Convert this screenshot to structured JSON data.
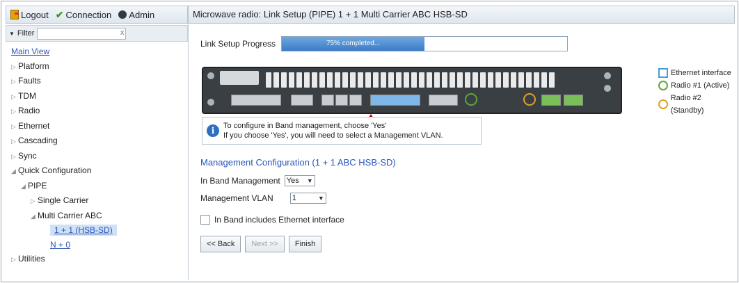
{
  "topbar": {
    "logout": "Logout",
    "connection": "Connection",
    "admin": "Admin"
  },
  "filter": {
    "label": "Filter",
    "value": "",
    "clear": "x"
  },
  "tree": {
    "main_view": "Main View",
    "platform": "Platform",
    "faults": "Faults",
    "tdm": "TDM",
    "radio": "Radio",
    "ethernet": "Ethernet",
    "cascading": "Cascading",
    "sync": "Sync",
    "quick_configuration": "Quick Configuration",
    "pipe": "PIPE",
    "single_carrier": "Single Carrier",
    "multi_carrier_abc": "Multi Carrier ABC",
    "hsb_sd": "1 + 1 (HSB-SD)",
    "n_plus_0": "N + 0",
    "utilities": "Utilities"
  },
  "main": {
    "title": "Microwave radio: Link Setup (PIPE) 1 + 1 Multi Carrier ABC HSB-SD",
    "progress_label": "Link Setup Progress",
    "progress_text": "75% completed...",
    "progress_value": 0.5,
    "info_line1": "To configure in Band management, choose 'Yes'",
    "info_line2": "If you choose 'Yes', you will need to select a Management VLAN.",
    "section_title": "Management Configuration (1 + 1 ABC HSB-SD)",
    "inband_label": "In Band Management",
    "inband_value": "Yes",
    "vlan_label": "Management VLAN",
    "vlan_value": "1",
    "checkbox_label": "In Band includes Ethernet interface",
    "back": "<< Back",
    "next": "Next >>",
    "finish": "Finish"
  },
  "legend": {
    "ethernet": "Ethernet interface",
    "radio1": "Radio #1 (Active)",
    "radio2": "Radio #2 (Standby)"
  },
  "colors": {
    "ethernet": "#4a9bd8",
    "radio1": "#5aa83a",
    "radio2": "#e0a020"
  }
}
